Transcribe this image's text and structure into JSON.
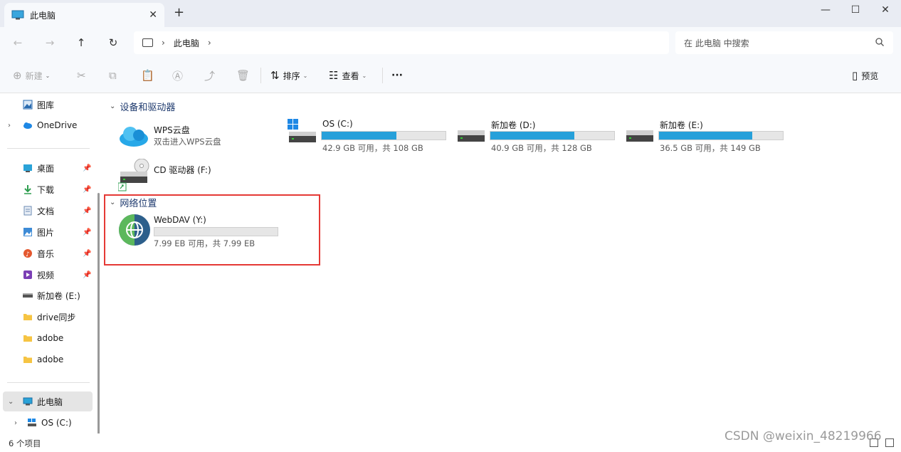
{
  "window": {
    "tab_title": "此电脑",
    "tab_close": "✕",
    "new_tab": "+",
    "minimize": "—",
    "maximize": "☐",
    "close": "✕"
  },
  "address": {
    "breadcrumb": "此电脑",
    "search_placeholder": "在 此电脑 中搜索"
  },
  "toolbar": {
    "new_label": "新建",
    "sort_label": "排序",
    "view_label": "查看",
    "more_label": "···",
    "preview_label": "预览"
  },
  "sidebar": {
    "items": [
      {
        "label": "图库",
        "icon": "gallery-icon"
      },
      {
        "label": "OneDrive",
        "icon": "cloud-icon"
      },
      {
        "label": "桌面",
        "icon": "desktop-icon",
        "pinned": true
      },
      {
        "label": "下载",
        "icon": "download-icon",
        "pinned": true
      },
      {
        "label": "文档",
        "icon": "document-icon",
        "pinned": true
      },
      {
        "label": "图片",
        "icon": "pictures-icon",
        "pinned": true
      },
      {
        "label": "音乐",
        "icon": "music-icon",
        "pinned": true
      },
      {
        "label": "视频",
        "icon": "video-icon",
        "pinned": true
      },
      {
        "label": "新加卷 (E:)",
        "icon": "drive-icon"
      },
      {
        "label": "drive同步",
        "icon": "folder-icon"
      },
      {
        "label": "adobe",
        "icon": "folder-icon"
      },
      {
        "label": "adobe",
        "icon": "folder-icon"
      },
      {
        "label": "此电脑",
        "icon": "pc-icon",
        "selected": true
      },
      {
        "label": "OS (C:)",
        "icon": "os-drive-icon"
      }
    ]
  },
  "content": {
    "group_devices": "设备和驱动器",
    "group_network": "网络位置",
    "wps": {
      "name": "WPS云盘",
      "sub": "双击进入WPS云盘"
    },
    "cd": {
      "name": "CD 驱动器 (F:)"
    },
    "drives": [
      {
        "name": "OS (C:)",
        "sub": "42.9 GB 可用，共 108 GB",
        "used_fraction": 0.603
      },
      {
        "name": "新加卷 (D:)",
        "sub": "40.9 GB 可用，共 128 GB",
        "used_fraction": 0.68
      },
      {
        "name": "新加卷 (E:)",
        "sub": "36.5 GB 可用，共 149 GB",
        "used_fraction": 0.755
      }
    ],
    "webdav": {
      "name": "WebDAV (Y:)",
      "sub": "7.99 EB 可用，共 7.99 EB",
      "used_fraction": 0.0
    }
  },
  "status": {
    "count": "6 个项目"
  },
  "watermark": "CSDN @weixin_48219966",
  "colors": {
    "accent_bar": "#26a0da",
    "highlight_box": "#e53935"
  }
}
